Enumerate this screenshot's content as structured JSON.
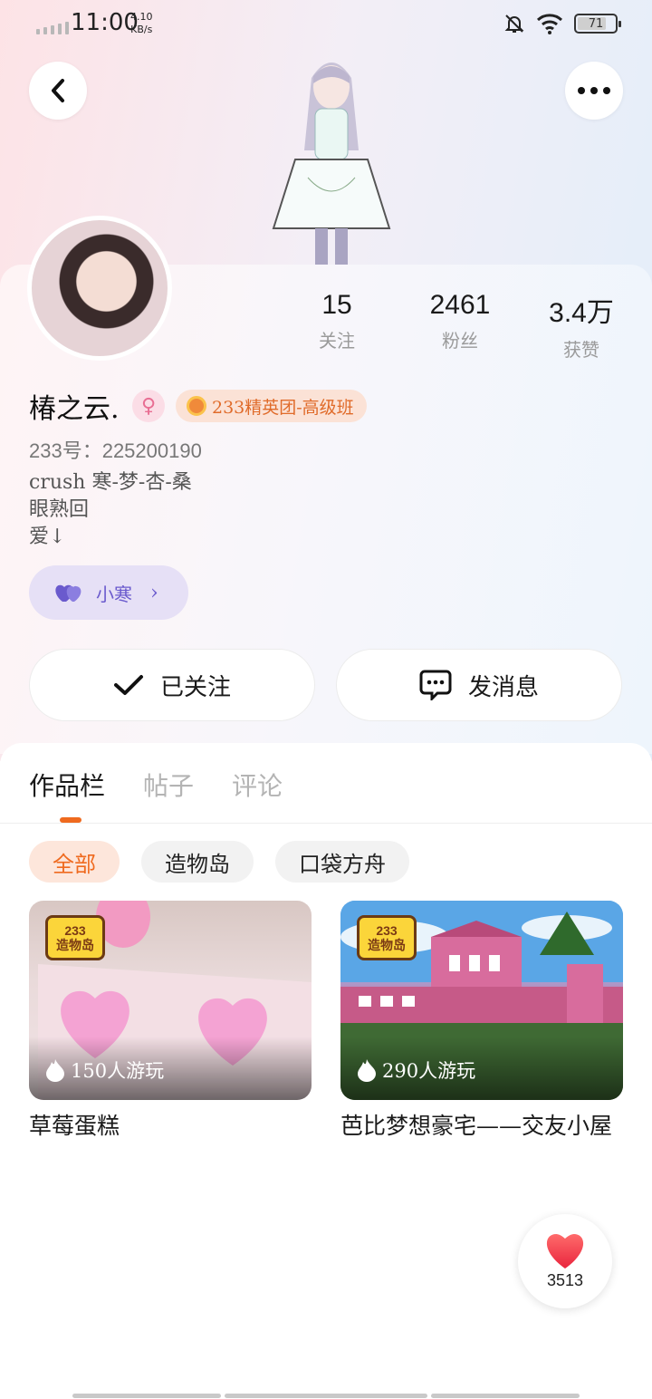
{
  "status_bar": {
    "time": "11:00",
    "net_speed_value": "4.10",
    "net_speed_unit": "KB/s",
    "battery": "71",
    "icons": [
      "signal-icon",
      "bell-muted-icon",
      "wifi-icon",
      "battery-icon"
    ]
  },
  "header": {
    "back_icon": "chevron-left-icon",
    "more_icon": "more-dots-icon"
  },
  "profile": {
    "name": "椿之云.",
    "gender_icon": "female-icon",
    "group_badge": "233精英团-高级班",
    "uid": "233号：225200190",
    "bio_lines": [
      "crush 寒-梦-杏-桑",
      "眼熟回",
      "爱↓"
    ],
    "cp_label": "小寒"
  },
  "stats": [
    {
      "value": "15",
      "label": "关注"
    },
    {
      "value": "2461",
      "label": "粉丝"
    },
    {
      "value": "3.4万",
      "label": "获赞"
    }
  ],
  "actions": {
    "follow_label": "已关注",
    "message_label": "发消息"
  },
  "tabs": [
    "作品栏",
    "帖子",
    "评论"
  ],
  "active_tab": "作品栏",
  "filters": [
    "全部",
    "造物岛",
    "口袋方舟"
  ],
  "active_filter": "全部",
  "works": [
    {
      "title": "草莓蛋糕",
      "plays": "150人游玩",
      "logo_top": "233",
      "logo_bottom": "造物岛"
    },
    {
      "title": "芭比梦想豪宅——交友小屋",
      "plays": "290人游玩",
      "logo_top": "233",
      "logo_bottom": "造物岛"
    }
  ],
  "like_fab": {
    "count": "3513"
  },
  "colors": {
    "accent": "#ef6a1f",
    "cp_purple": "#6a5acd",
    "like_red": "#f23a4a"
  }
}
